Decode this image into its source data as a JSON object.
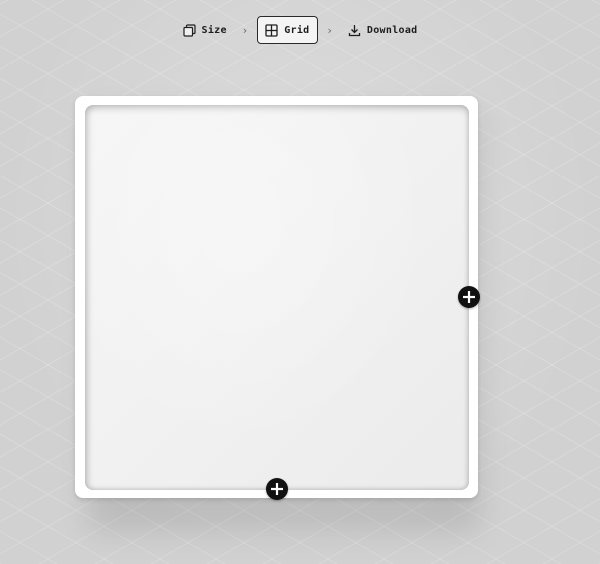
{
  "stepper": {
    "steps": [
      {
        "label": "Size",
        "icon": "layers-icon",
        "active": false
      },
      {
        "label": "Grid",
        "icon": "grid-icon",
        "active": true
      },
      {
        "label": "Download",
        "icon": "download-icon",
        "active": false
      }
    ],
    "separator": "›"
  },
  "canvas": {
    "add_right_icon": "plus-circle-icon",
    "add_bottom_icon": "plus-circle-icon"
  },
  "colors": {
    "background": "#d1d1d1",
    "frame": "#ffffff",
    "accent": "#111111"
  }
}
